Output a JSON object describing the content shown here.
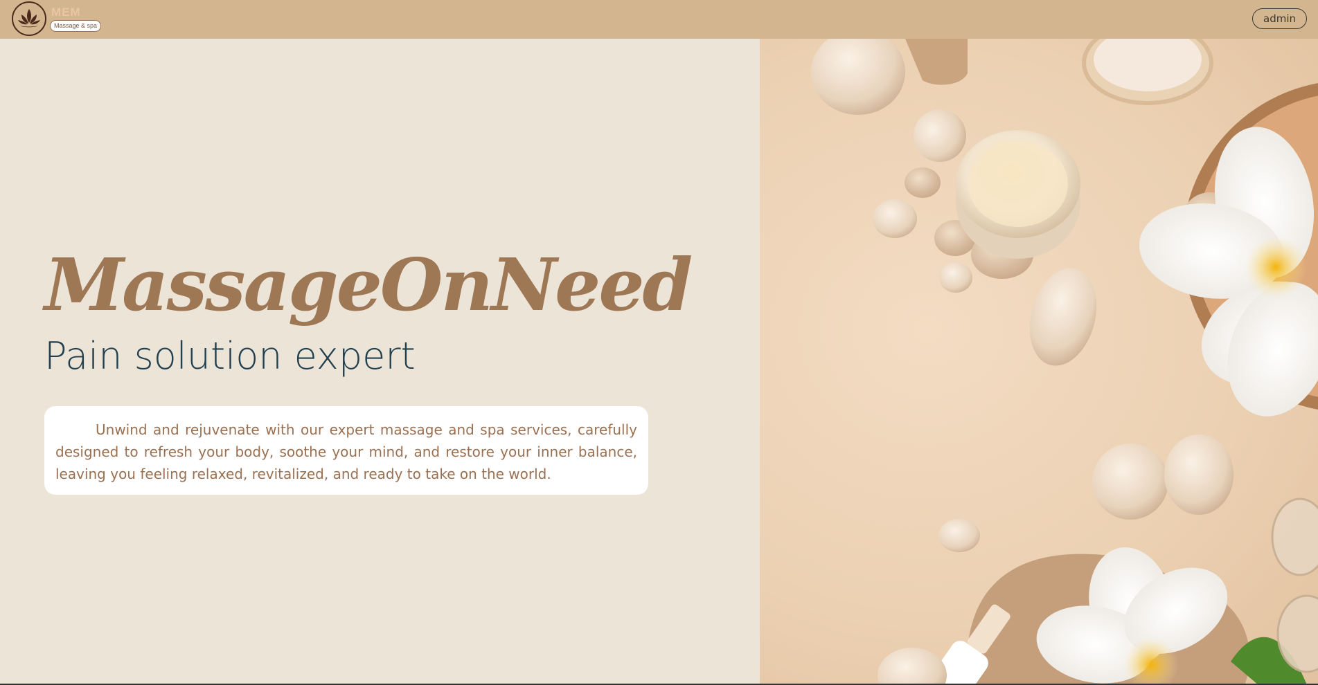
{
  "header": {
    "brand_word": "MEM",
    "brand_tagline": "Massage & spa",
    "admin_label": "admin"
  },
  "hero": {
    "title": "MassageOnNeed",
    "subtitle": "Pain solution expert",
    "description": "Unwind and rejuvenate with our expert massage and spa services, carefully designed to refresh your body, soothe your mind, and restore your inner balance, leaving you feeling relaxed, revitalized, and ready to take on the world."
  },
  "colors": {
    "header_bg": "#d3b58f",
    "page_bg": "#ede4d8",
    "title": "#9e7754",
    "subtitle": "#23404f",
    "description": "#9b7050"
  },
  "icons": {
    "logo": "lotus-icon"
  }
}
